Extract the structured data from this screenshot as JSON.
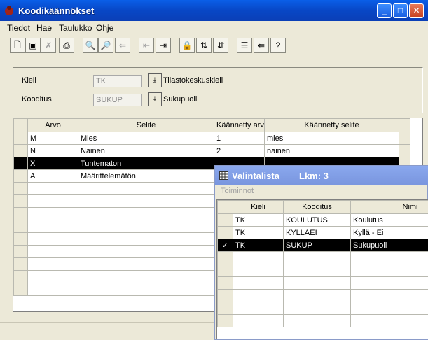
{
  "window": {
    "title": "Koodikäännökset"
  },
  "controls": {
    "minimize": "_",
    "maximize": "□",
    "close": "✕"
  },
  "menu": [
    {
      "label": "Tiedot"
    },
    {
      "label": "Hae"
    },
    {
      "label": "Taulukko"
    },
    {
      "label": "Ohje"
    }
  ],
  "toolbar": [
    {
      "icon": "new-document-icon",
      "glyph": "🗋"
    },
    {
      "icon": "save-icon",
      "glyph": "▣"
    },
    {
      "icon": "delete-icon",
      "glyph": "✗"
    },
    {
      "icon": "print-icon",
      "glyph": "⎙"
    },
    {
      "icon": "print-preview-icon",
      "glyph": "🔍"
    },
    {
      "icon": "search-icon",
      "glyph": "🔎"
    },
    {
      "icon": "import-icon",
      "glyph": "⇐"
    },
    {
      "icon": "row-in-icon",
      "glyph": "⇤"
    },
    {
      "icon": "row-out-icon",
      "glyph": "⇥"
    },
    {
      "icon": "lock-icon",
      "glyph": "🔒"
    },
    {
      "icon": "sort-ascending-icon",
      "glyph": "⇅"
    },
    {
      "icon": "sort-descending-icon",
      "glyph": "⇵"
    },
    {
      "icon": "list-icon",
      "glyph": "☰"
    },
    {
      "icon": "export-icon",
      "glyph": "⇚"
    },
    {
      "icon": "help-icon",
      "glyph": "?"
    }
  ],
  "params": {
    "kieli": {
      "label": "Kieli",
      "value": "TK",
      "name": "Tilastokeskuskieli"
    },
    "koodistus": {
      "label": "Kooditus",
      "value": "SUKUP",
      "name": "Sukupuoli"
    }
  },
  "grid": {
    "columns": [
      "Arvo",
      "Selite",
      "Käännetty arvo",
      "Käännetty selite"
    ],
    "rows": [
      [
        "M",
        "Mies",
        "1",
        "mies"
      ],
      [
        "N",
        "Nainen",
        "2",
        "nainen"
      ],
      [
        "X",
        "Tuntematon",
        "",
        ""
      ],
      [
        "A",
        "Määrittelemätön",
        "",
        ""
      ]
    ],
    "selected_row": 2
  },
  "popup": {
    "title": "Valintalista",
    "count_label": "Lkm: 3",
    "menu": "Toiminnot",
    "columns": [
      "Kieli",
      "Kooditus",
      "Nimi"
    ],
    "rows": [
      [
        "TK",
        "KOULUTUS",
        "Koulutus"
      ],
      [
        "TK",
        "KYLLAEI",
        "Kyllä - Ei"
      ],
      [
        "TK",
        "SUKUP",
        "Sukupuoli"
      ]
    ],
    "selected_row": 2,
    "check_mark": "✓"
  }
}
